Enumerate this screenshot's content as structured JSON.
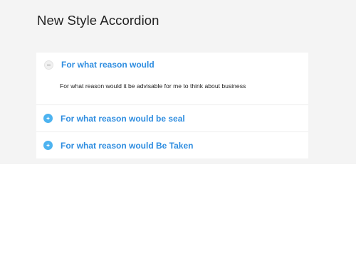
{
  "page": {
    "title": "New Style Accordion"
  },
  "accordion": {
    "items": [
      {
        "title": "For what reason would",
        "expanded": true,
        "icon": "minus-icon",
        "body": "For what reason would it be advisable for me to think about business"
      },
      {
        "title": "For what reason would be seal",
        "expanded": false,
        "icon": "plus-icon"
      },
      {
        "title": "For what reason would Be Taken",
        "expanded": false,
        "icon": "plus-icon"
      }
    ]
  },
  "colors": {
    "background_panel": "#f4f4f4",
    "accent_title": "#2e8de0",
    "plus_icon": "#4db3f0",
    "page_title": "#222222"
  }
}
